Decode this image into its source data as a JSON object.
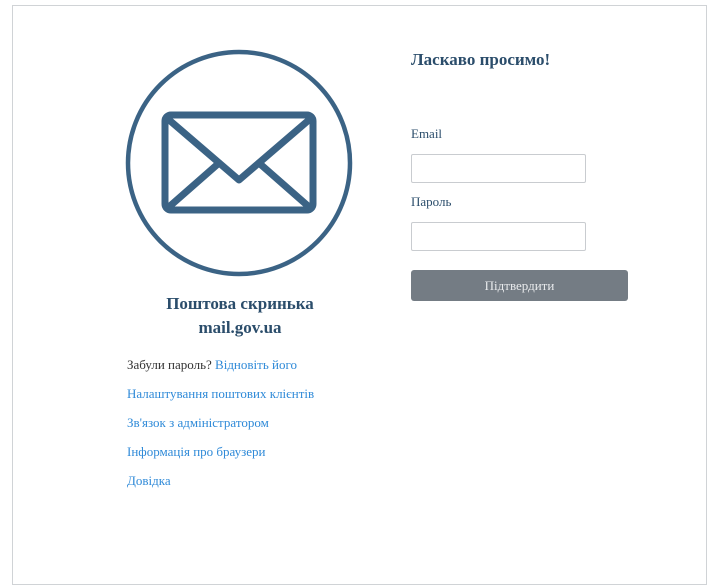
{
  "brand": {
    "title_line1": "Поштова скринька",
    "title_line2": "mail.gov.ua",
    "icon": "envelope-icon",
    "color": "#2b4d6b"
  },
  "links": {
    "forgot_prefix": "Забули пароль?",
    "restore": "Відновіть його",
    "mail_clients": "Налаштування поштових клієнтів",
    "contact_admin": "Зв'язок з адміністратором",
    "browsers_info": "Інформація про браузери",
    "help": "Довідка",
    "color": "#2f8ad8"
  },
  "login_form": {
    "welcome": "Ласкаво просимо!",
    "email_label": "Email",
    "email_value": "",
    "password_label": "Пароль",
    "password_value": "",
    "submit_label": "Підтвердити",
    "submit_color": "#747c84"
  }
}
